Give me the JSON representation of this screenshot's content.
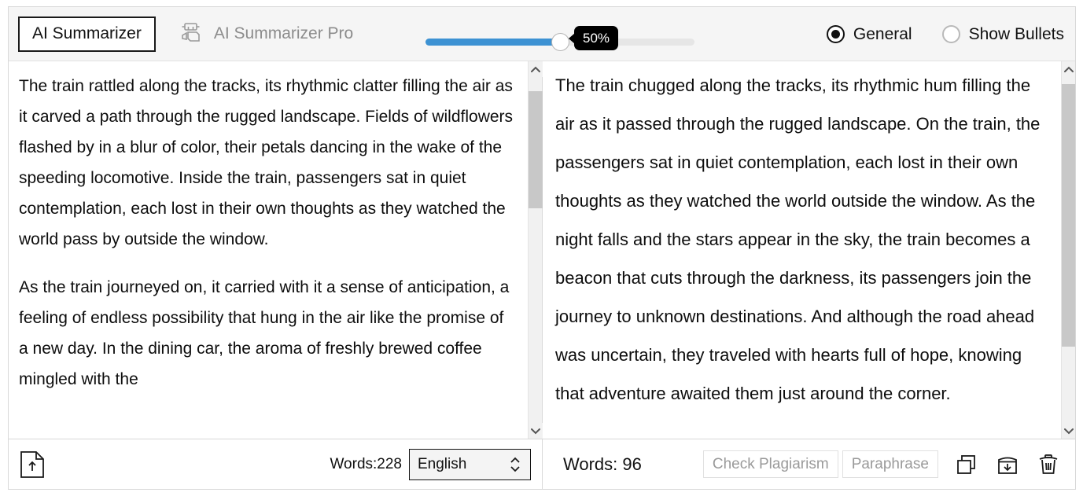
{
  "header": {
    "tab_active_label": "AI Summarizer",
    "tab_pro_label": "AI Summarizer Pro",
    "robot_icon": "robot-icon",
    "slider": {
      "value_label": "50%",
      "percent": 50,
      "fill_color": "#3d92d3",
      "track_color": "#e6e6e6",
      "tooltip_bg": "#000000"
    },
    "radios": [
      {
        "label": "General",
        "selected": true
      },
      {
        "label": "Show Bullets",
        "selected": false
      }
    ]
  },
  "left_panel": {
    "paragraphs": [
      "The train rattled along the tracks, its rhythmic clatter filling the air as it carved a path through the rugged landscape. Fields of wildflowers flashed by in a blur of color, their petals dancing in the wake of the speeding locomotive. Inside the train, passengers sat in quiet contemplation, each lost in their own thoughts as they watched the world pass by outside the window.",
      "As the train journeyed on, it carried with it a sense of anticipation, a feeling of endless possibility that hung in the air like the promise of a new day. In the dining car, the aroma of freshly brewed coffee mingled with the"
    ],
    "scrollbar": {
      "thumb_top_pct": 4,
      "thumb_height_pct": 34
    },
    "footer": {
      "upload_icon": "upload-document-icon",
      "words_label": "Words:228",
      "language_value": "English",
      "language_options": [
        "English"
      ]
    }
  },
  "right_panel": {
    "paragraphs": [
      "The train chugged along the tracks, its rhythmic hum filling the air as it passed through the rugged landscape. On the train, the passengers sat in quiet contemplation, each lost in their own thoughts as they watched the world outside the window. As the night falls and the stars appear in the sky, the train becomes a beacon that cuts through the darkness, its passengers join the journey to unknown destinations. And although the road ahead was uncertain, they traveled with hearts full of hope, knowing that adventure awaited them just around the corner."
    ],
    "scrollbar": {
      "thumb_top_pct": 2,
      "thumb_height_pct": 76
    },
    "footer": {
      "words_label": "Words: 96",
      "check_plagiarism_label": "Check Plagiarism",
      "paraphrase_label": "Paraphrase",
      "icons": [
        "copy-icon",
        "download-icon",
        "trash-icon"
      ]
    }
  }
}
